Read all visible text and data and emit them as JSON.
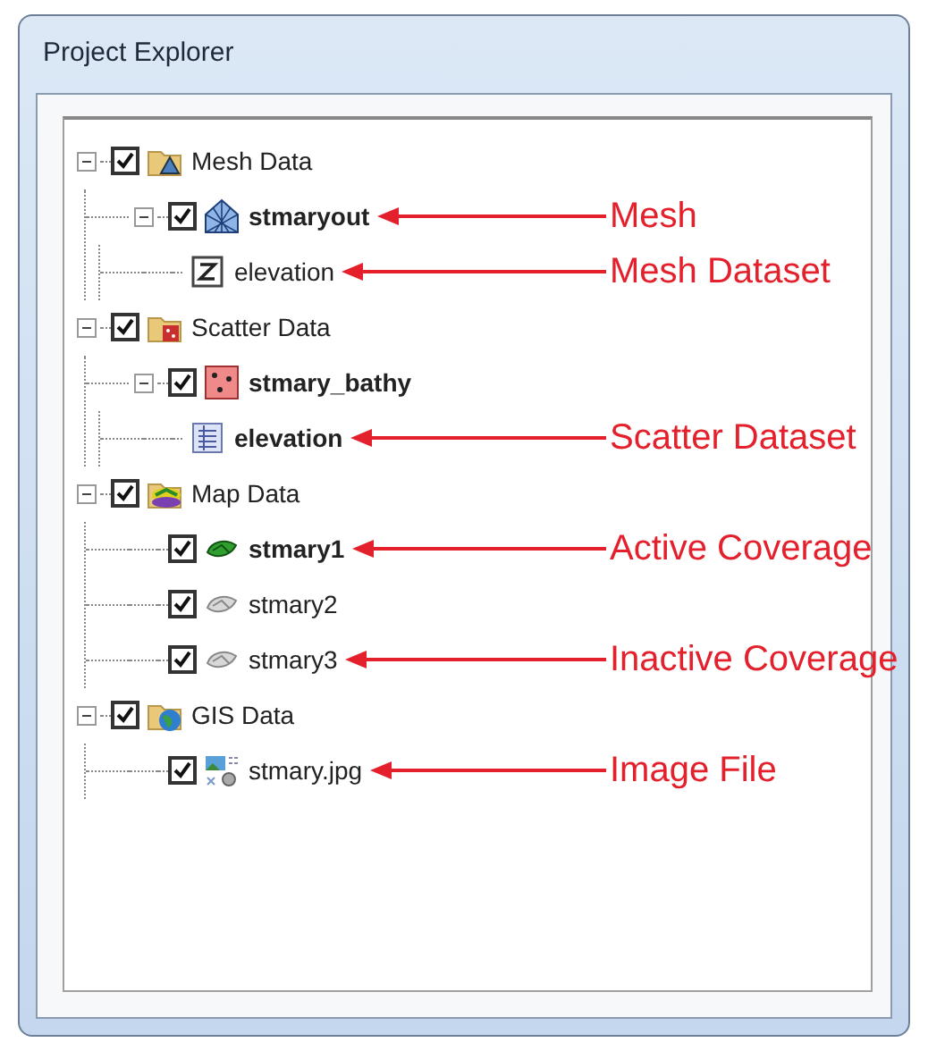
{
  "window": {
    "title": "Project Explorer"
  },
  "tree": [
    {
      "label": "Mesh Data",
      "kind": "mesh-folder",
      "checked": true,
      "expanded": true,
      "active": false,
      "children": [
        {
          "label": "stmaryout",
          "kind": "mesh",
          "checked": true,
          "expanded": true,
          "active": true,
          "annotation": "Mesh",
          "children": [
            {
              "label": "elevation",
              "kind": "z-dataset",
              "active": false,
              "annotation": "Mesh Dataset"
            }
          ]
        }
      ]
    },
    {
      "label": "Scatter Data",
      "kind": "scatter-folder",
      "checked": true,
      "expanded": true,
      "active": false,
      "children": [
        {
          "label": "stmary_bathy",
          "kind": "scatter",
          "checked": true,
          "expanded": true,
          "active": true,
          "children": [
            {
              "label": "elevation",
              "kind": "table-dataset",
              "active": true,
              "annotation": "Scatter Dataset"
            }
          ]
        }
      ]
    },
    {
      "label": "Map Data",
      "kind": "map-folder",
      "checked": true,
      "expanded": true,
      "active": false,
      "children": [
        {
          "label": "stmary1",
          "kind": "coverage",
          "checked": true,
          "active": true,
          "annotation": "Active Coverage"
        },
        {
          "label": "stmary2",
          "kind": "coverage",
          "checked": true,
          "active": false
        },
        {
          "label": "stmary3",
          "kind": "coverage",
          "checked": true,
          "active": false,
          "annotation": "Inactive Coverage"
        }
      ]
    },
    {
      "label": "GIS Data",
      "kind": "gis-folder",
      "checked": true,
      "expanded": true,
      "active": false,
      "children": [
        {
          "label": "stmary.jpg",
          "kind": "image",
          "checked": true,
          "active": false,
          "annotation": "Image File"
        }
      ]
    }
  ]
}
